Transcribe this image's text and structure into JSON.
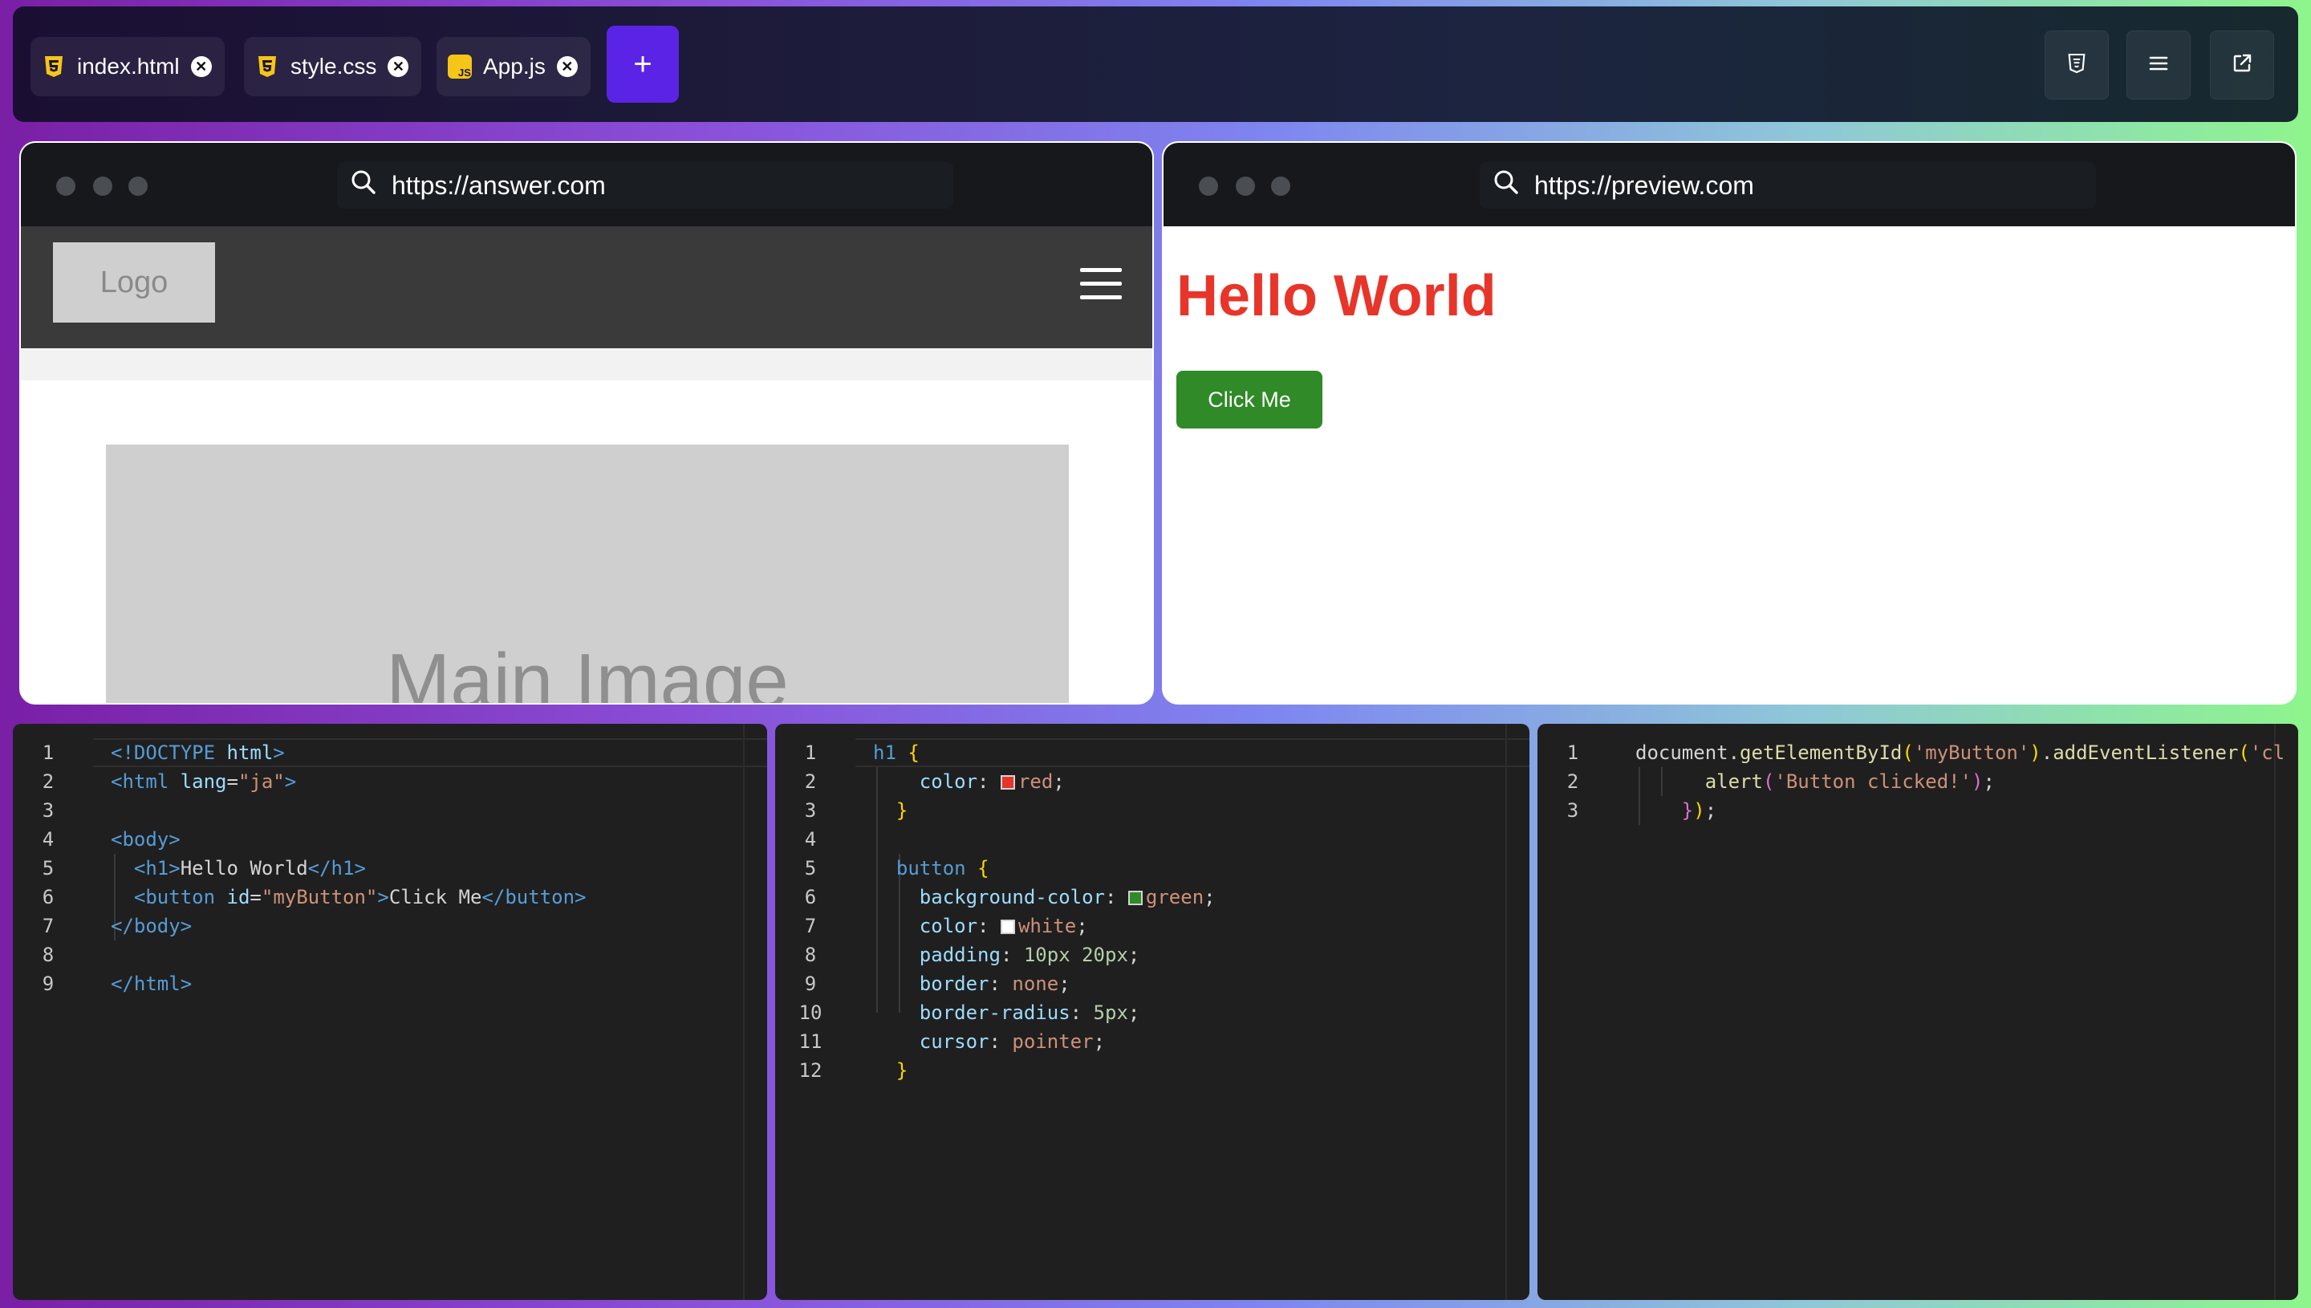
{
  "tabs": [
    {
      "label": "index.html",
      "icon": "html5-icon",
      "color": "#f5c518"
    },
    {
      "label": "style.css",
      "icon": "css3-icon",
      "color": "#f5c518"
    },
    {
      "label": "App.js",
      "icon": "js-icon",
      "color": "#f5c518"
    }
  ],
  "add_tab_label": "+",
  "answer_pane": {
    "url": "https://answer.com",
    "logo_text": "Logo",
    "main_image_text": "Main Image"
  },
  "preview_pane": {
    "url": "https://preview.com",
    "heading": "Hello World",
    "button_label": "Click Me",
    "heading_color": "#e8352a",
    "button_color": "#2f8a27"
  },
  "editors": {
    "html": {
      "line_numbers": [
        "1",
        "2",
        "3",
        "4",
        "5",
        "6",
        "7",
        "8",
        "9"
      ]
    },
    "css": {
      "line_numbers": [
        "1",
        "2",
        "3",
        "4",
        "5",
        "6",
        "7",
        "8",
        "9",
        "10",
        "11",
        "12"
      ]
    },
    "js": {
      "line_numbers": [
        "1",
        "2",
        "3"
      ]
    }
  }
}
